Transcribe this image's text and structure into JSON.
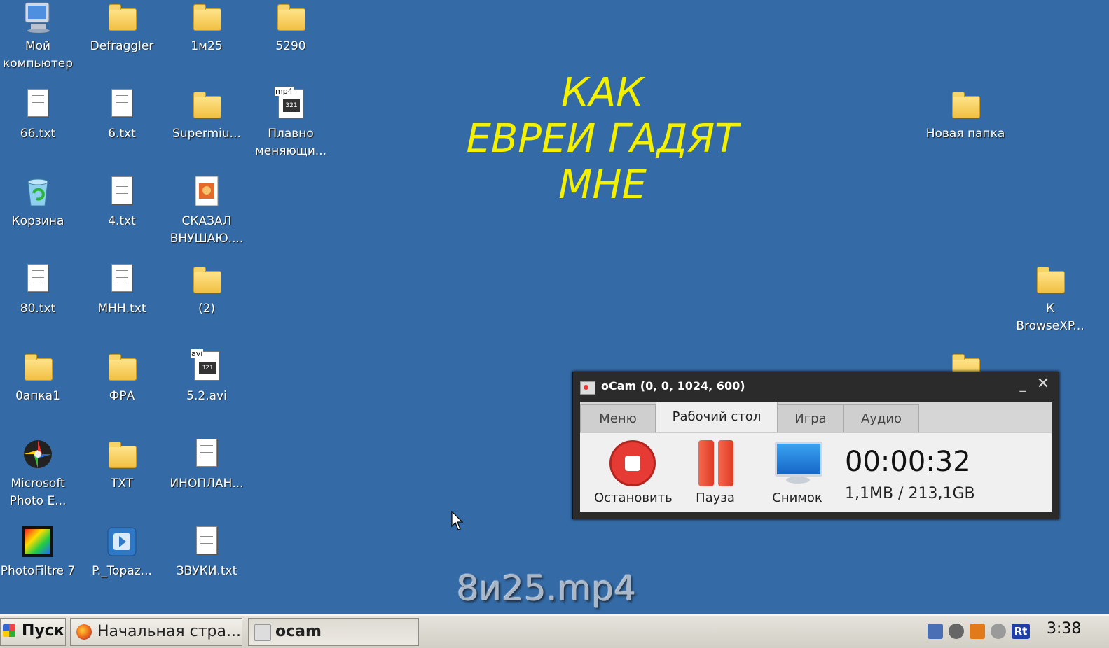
{
  "desktop": {
    "icons": [
      {
        "label": "Мой\nкомпьютер",
        "type": "computer"
      },
      {
        "label": "Defraggler",
        "type": "folder"
      },
      {
        "label": "1м25",
        "type": "folder"
      },
      {
        "label": "5290",
        "type": "folder"
      },
      {
        "label": "66.txt",
        "type": "txt"
      },
      {
        "label": "6.txt",
        "type": "txt"
      },
      {
        "label": "Supermiu...",
        "type": "folder"
      },
      {
        "label": "Плавно\nменяющи...",
        "type": "video",
        "ext": "mp4"
      },
      {
        "label": "Корзина",
        "type": "recycle"
      },
      {
        "label": "4.txt",
        "type": "txt"
      },
      {
        "label": "СКАЗАЛ\nВНУШАЮ....",
        "type": "image-doc"
      },
      {
        "label": "80.txt",
        "type": "txt"
      },
      {
        "label": "МНН.txt",
        "type": "txt"
      },
      {
        "label": "(2)",
        "type": "folder"
      },
      {
        "label": "0апка1",
        "type": "folder"
      },
      {
        "label": "ФРА",
        "type": "folder"
      },
      {
        "label": "5.2.avi",
        "type": "video",
        "ext": "avi"
      },
      {
        "label": "Microsoft\nPhoto E...",
        "type": "photo-editor"
      },
      {
        "label": "TXT",
        "type": "folder"
      },
      {
        "label": "ИНОПЛАН...",
        "type": "txt"
      },
      {
        "label": "PhotoFiltre 7",
        "type": "photofiltre"
      },
      {
        "label": "P._Topaz...",
        "type": "topaz"
      },
      {
        "label": "ЗВУКИ.txt",
        "type": "txt"
      },
      {
        "label": "Новая папка",
        "type": "folder"
      },
      {
        "label": "К\nBrowseXP...",
        "type": "folder"
      },
      {
        "label": "",
        "type": "folder"
      }
    ],
    "headline": [
      "КАК",
      "ЕВРЕИ ГАДЯТ",
      "МНЕ"
    ],
    "watermark": "8и25.mp4"
  },
  "ocam": {
    "title": "oCam (0, 0, 1024, 600)",
    "tabs": [
      "Меню",
      "Рабочий стол",
      "Игра",
      "Аудио"
    ],
    "active_tab": "Рабочий стол",
    "stop_label": "Остановить",
    "pause_label": "Пауза",
    "snapshot_label": "Снимок",
    "timer": "00:00:32",
    "sizes": "1,1MB / 213,1GB"
  },
  "taskbar": {
    "start_label": "Пуск",
    "tasks": [
      "Начальная стра...",
      "ocam"
    ],
    "clock": "3:38",
    "tray_rt": "Rt"
  }
}
